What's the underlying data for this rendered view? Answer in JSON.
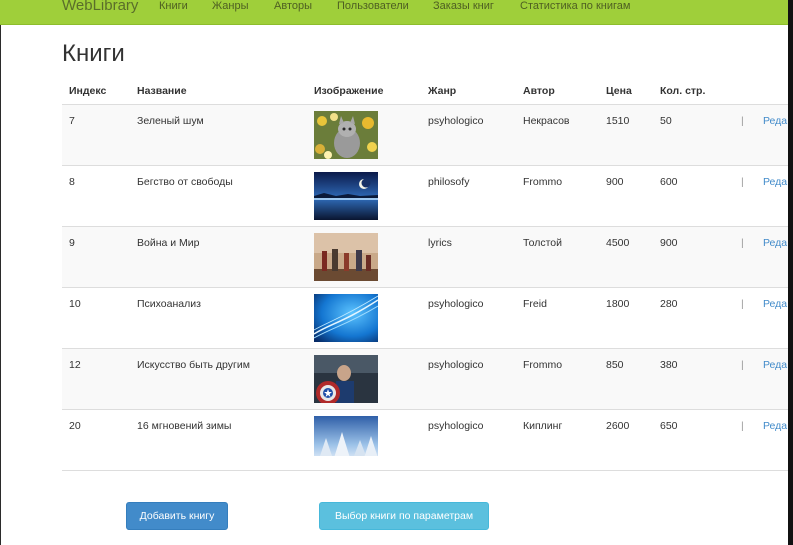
{
  "navbar": {
    "brand": "WebLibrary",
    "links": [
      "Книги",
      "Жанры",
      "Авторы",
      "Пользователи",
      "Заказы книг",
      "Статистика по книгам"
    ]
  },
  "page_title": "Книги",
  "table": {
    "headers": [
      "Индекс",
      "Название",
      "Изображение",
      "Жанр",
      "Автор",
      "Цена",
      "Кол. стр."
    ],
    "separator": "|",
    "edit_label": "Реда",
    "rows": [
      {
        "index": "7",
        "title": "Зеленый шум",
        "image": "cat-in-flowers",
        "genre": "psyhologico",
        "author": "Некрасов",
        "price": "1510",
        "pages": "50"
      },
      {
        "index": "8",
        "title": "Бегство от свободы",
        "image": "night-lake-moon",
        "genre": "philosofy",
        "author": "Frommo",
        "price": "900",
        "pages": "600"
      },
      {
        "index": "9",
        "title": "Война и Мир",
        "image": "battle-painting",
        "genre": "lyrics",
        "author": "Толстой",
        "price": "4500",
        "pages": "900"
      },
      {
        "index": "10",
        "title": "Психоанализ",
        "image": "blue-abstract-wave",
        "genre": "psyhologico",
        "author": "Freid",
        "price": "1800",
        "pages": "280"
      },
      {
        "index": "12",
        "title": "Искусство быть другим",
        "image": "superhero-with-shield",
        "genre": "psyhologico",
        "author": "Frommo",
        "price": "850",
        "pages": "380"
      },
      {
        "index": "20",
        "title": "16 мгновений зимы",
        "image": "snowy-winter-forest",
        "genre": "psyhologico",
        "author": "Киплинг",
        "price": "2600",
        "pages": "650"
      }
    ]
  },
  "buttons": {
    "add_book": "Добавить книгу",
    "select_by_params": "Выбор книги по параметрам"
  },
  "colors": {
    "navbar": "#9fcf3a",
    "primary": "#428bca",
    "info": "#5bc0de",
    "link": "#428bca"
  }
}
